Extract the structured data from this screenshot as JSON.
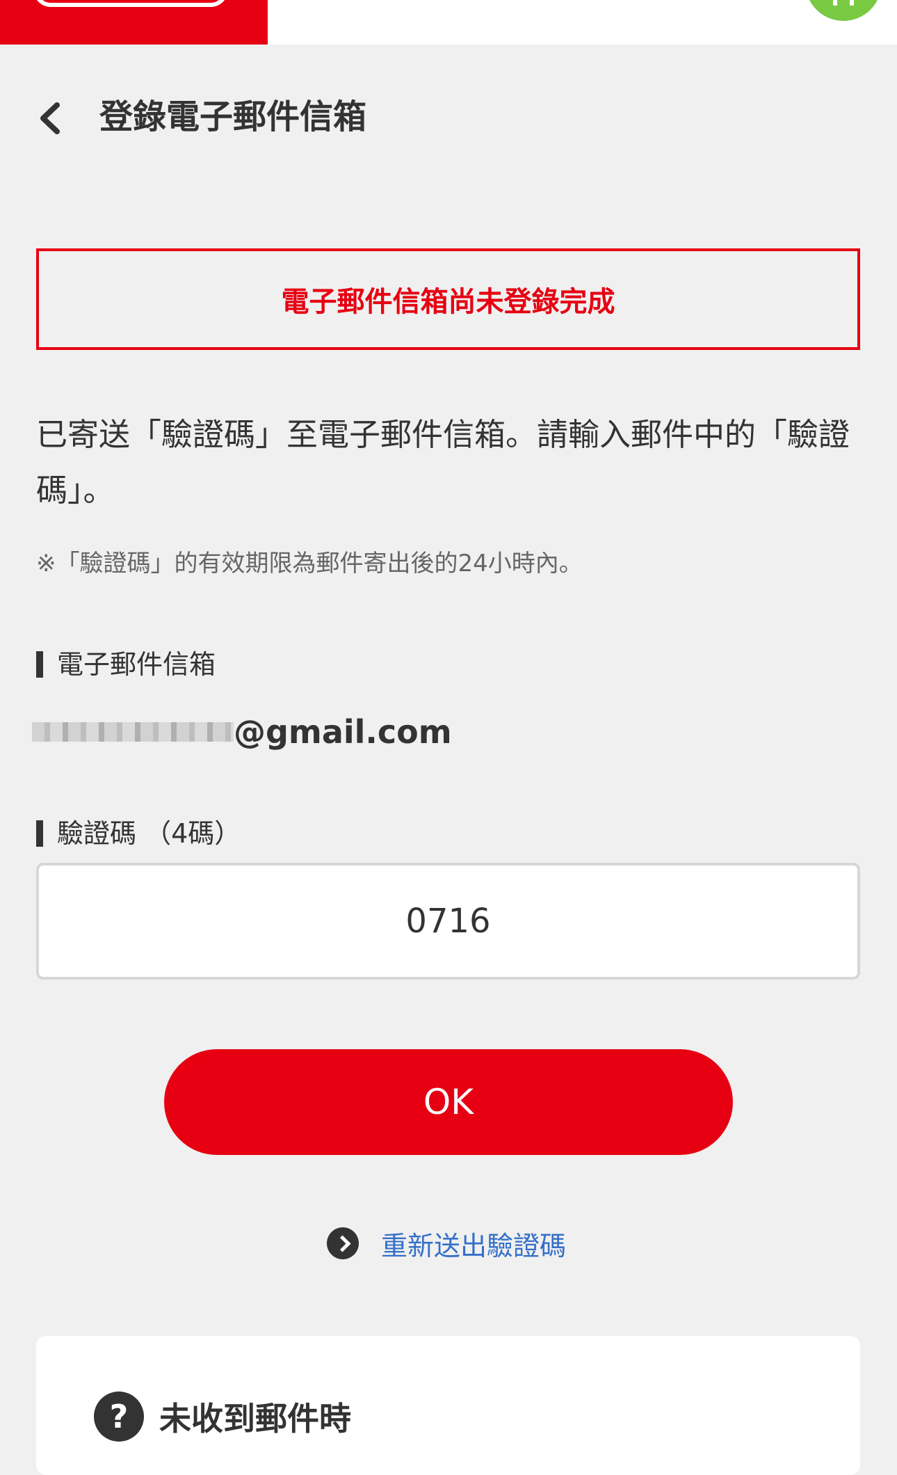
{
  "header": {
    "brand_color": "#e60012",
    "avatar_color": "#7ac943"
  },
  "page": {
    "title": "登錄電子郵件信箱",
    "back_icon": "chevron-left-icon"
  },
  "alert": {
    "text": "電子郵件信箱尚未登錄完成",
    "color": "#e60012"
  },
  "instruction": {
    "text": "已寄送「驗證碼」至電子郵件信箱。請輸入郵件中的「驗證碼」。",
    "note": "※「驗證碼」的有效期限為郵件寄出後的24小時內。"
  },
  "email_field": {
    "label": "電子郵件信箱",
    "domain": "@gmail.com"
  },
  "code_field": {
    "label": "驗證碼 （4碼）",
    "value": "0716"
  },
  "ok_button": {
    "label": "OK"
  },
  "resend": {
    "label": "重新送出驗證碼",
    "icon": "chevron-right-circle-icon",
    "color": "#3570c9"
  },
  "help": {
    "icon": "question-icon",
    "icon_glyph": "?",
    "title": "未收到郵件時"
  }
}
